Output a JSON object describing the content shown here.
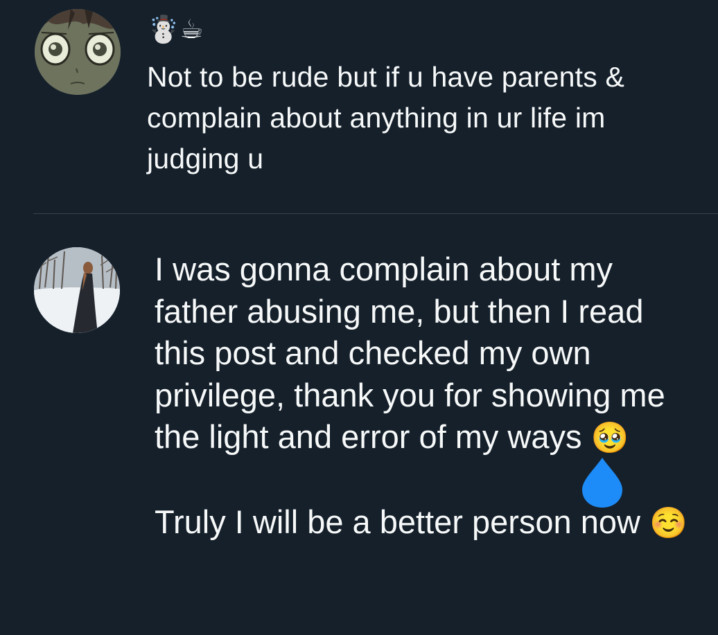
{
  "post": {
    "author_display_emoji": "☃️☕",
    "text": "Not to be rude but if u have parents & complain about anything in ur life im judging u",
    "avatar_icon": "anime-face-avatar"
  },
  "reply": {
    "avatar_icon": "snowy-figure-avatar",
    "text_part1": "I was gonna complain about my father abusing me, but then I read this post and checked my own privilege, thank you for showing me the light and error of my ways",
    "emoji1": "🥹",
    "text_part2": "Truly I will be a better person now",
    "emoji2": "☺️"
  },
  "icons": {
    "drop": "water-drop-icon"
  },
  "colors": {
    "background": "#15202b",
    "text": "#f7f9f9",
    "divider": "#38444d",
    "drop": "#1d8cf8"
  }
}
